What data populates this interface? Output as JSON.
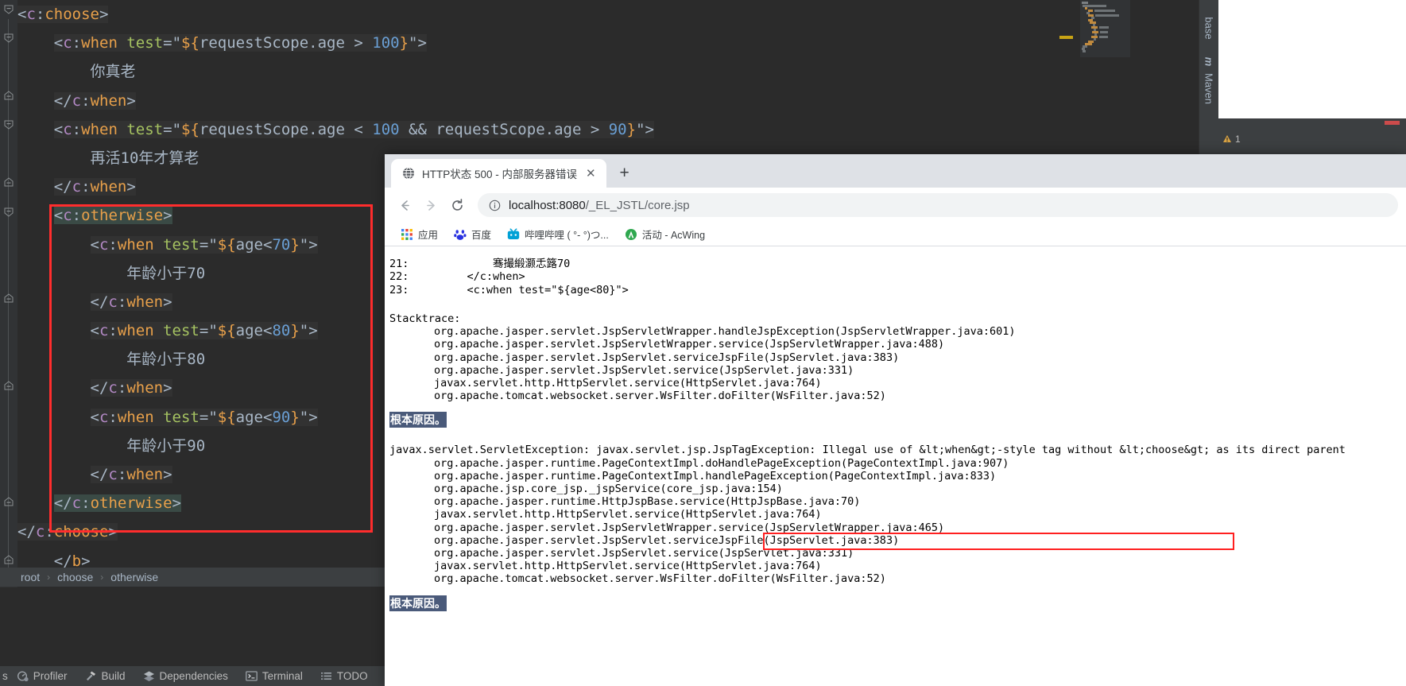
{
  "ide": {
    "editor_code": [
      {
        "indent": 0,
        "bg": "hl",
        "tokens": [
          {
            "t": "<",
            "c": "punc"
          },
          {
            "t": "c",
            "c": "ns"
          },
          {
            "t": ":",
            "c": "punc"
          },
          {
            "t": "choose",
            "c": "tag"
          },
          {
            "t": ">",
            "c": "punc"
          }
        ]
      },
      {
        "indent": 1,
        "bg": "hl",
        "tokens": [
          {
            "t": "<",
            "c": "punc"
          },
          {
            "t": "c",
            "c": "ns"
          },
          {
            "t": ":",
            "c": "punc"
          },
          {
            "t": "when",
            "c": "tag"
          },
          {
            "t": " ",
            "c": "punc"
          },
          {
            "t": "test",
            "c": "attr"
          },
          {
            "t": "=",
            "c": "punc"
          },
          {
            "t": "\"",
            "c": "str"
          },
          {
            "t": "${",
            "c": "el"
          },
          {
            "t": "requestScope.age",
            "c": "str"
          },
          {
            "t": " > ",
            "c": "op"
          },
          {
            "t": "100",
            "c": "num"
          },
          {
            "t": "}",
            "c": "el"
          },
          {
            "t": "\"",
            "c": "str"
          },
          {
            "t": ">",
            "c": "punc"
          }
        ]
      },
      {
        "indent": 2,
        "bg": "",
        "tokens": [
          {
            "t": "你真老",
            "c": "txt"
          }
        ]
      },
      {
        "indent": 1,
        "bg": "hl",
        "tokens": [
          {
            "t": "</",
            "c": "punc"
          },
          {
            "t": "c",
            "c": "ns"
          },
          {
            "t": ":",
            "c": "punc"
          },
          {
            "t": "when",
            "c": "tag"
          },
          {
            "t": ">",
            "c": "punc"
          }
        ]
      },
      {
        "indent": 1,
        "bg": "hl",
        "tokens": [
          {
            "t": "<",
            "c": "punc"
          },
          {
            "t": "c",
            "c": "ns"
          },
          {
            "t": ":",
            "c": "punc"
          },
          {
            "t": "when",
            "c": "tag"
          },
          {
            "t": " ",
            "c": "punc"
          },
          {
            "t": "test",
            "c": "attr"
          },
          {
            "t": "=",
            "c": "punc"
          },
          {
            "t": "\"",
            "c": "str"
          },
          {
            "t": "${",
            "c": "el"
          },
          {
            "t": "requestScope.age",
            "c": "str"
          },
          {
            "t": " < ",
            "c": "op"
          },
          {
            "t": "100",
            "c": "num"
          },
          {
            "t": " && ",
            "c": "op"
          },
          {
            "t": "requestScope.age",
            "c": "str"
          },
          {
            "t": " > ",
            "c": "op"
          },
          {
            "t": "90",
            "c": "num"
          },
          {
            "t": "}",
            "c": "el"
          },
          {
            "t": "\"",
            "c": "str"
          },
          {
            "t": ">",
            "c": "punc"
          }
        ]
      },
      {
        "indent": 2,
        "bg": "",
        "tokens": [
          {
            "t": "再活10年才算老",
            "c": "txt"
          }
        ]
      },
      {
        "indent": 1,
        "bg": "hl",
        "tokens": [
          {
            "t": "</",
            "c": "punc"
          },
          {
            "t": "c",
            "c": "ns"
          },
          {
            "t": ":",
            "c": "punc"
          },
          {
            "t": "when",
            "c": "tag"
          },
          {
            "t": ">",
            "c": "punc"
          }
        ]
      },
      {
        "indent": 1,
        "bg": "sel",
        "tokens": [
          {
            "t": "<",
            "c": "punc"
          },
          {
            "t": "c",
            "c": "ns"
          },
          {
            "t": ":",
            "c": "punc"
          },
          {
            "t": "otherwise",
            "c": "tag"
          },
          {
            "t": ">",
            "c": "punc"
          }
        ]
      },
      {
        "indent": 2,
        "bg": "hl",
        "tokens": [
          {
            "t": "<",
            "c": "punc"
          },
          {
            "t": "c",
            "c": "ns"
          },
          {
            "t": ":",
            "c": "punc"
          },
          {
            "t": "when",
            "c": "tag"
          },
          {
            "t": " ",
            "c": "punc"
          },
          {
            "t": "test",
            "c": "attr"
          },
          {
            "t": "=",
            "c": "punc"
          },
          {
            "t": "\"",
            "c": "str"
          },
          {
            "t": "${",
            "c": "el"
          },
          {
            "t": "age",
            "c": "str"
          },
          {
            "t": "<",
            "c": "op"
          },
          {
            "t": "70",
            "c": "num"
          },
          {
            "t": "}",
            "c": "el"
          },
          {
            "t": "\"",
            "c": "str"
          },
          {
            "t": ">",
            "c": "punc"
          }
        ]
      },
      {
        "indent": 3,
        "bg": "",
        "tokens": [
          {
            "t": "年龄小于70",
            "c": "txt"
          }
        ]
      },
      {
        "indent": 2,
        "bg": "hl",
        "tokens": [
          {
            "t": "</",
            "c": "punc"
          },
          {
            "t": "c",
            "c": "ns"
          },
          {
            "t": ":",
            "c": "punc"
          },
          {
            "t": "when",
            "c": "tag"
          },
          {
            "t": ">",
            "c": "punc"
          }
        ]
      },
      {
        "indent": 2,
        "bg": "hl",
        "tokens": [
          {
            "t": "<",
            "c": "punc"
          },
          {
            "t": "c",
            "c": "ns"
          },
          {
            "t": ":",
            "c": "punc"
          },
          {
            "t": "when",
            "c": "tag"
          },
          {
            "t": " ",
            "c": "punc"
          },
          {
            "t": "test",
            "c": "attr"
          },
          {
            "t": "=",
            "c": "punc"
          },
          {
            "t": "\"",
            "c": "str"
          },
          {
            "t": "${",
            "c": "el"
          },
          {
            "t": "age",
            "c": "str"
          },
          {
            "t": "<",
            "c": "op"
          },
          {
            "t": "80",
            "c": "num"
          },
          {
            "t": "}",
            "c": "el"
          },
          {
            "t": "\"",
            "c": "str"
          },
          {
            "t": ">",
            "c": "punc"
          }
        ]
      },
      {
        "indent": 3,
        "bg": "",
        "tokens": [
          {
            "t": "年龄小于80",
            "c": "txt"
          }
        ]
      },
      {
        "indent": 2,
        "bg": "hl",
        "tokens": [
          {
            "t": "</",
            "c": "punc"
          },
          {
            "t": "c",
            "c": "ns"
          },
          {
            "t": ":",
            "c": "punc"
          },
          {
            "t": "when",
            "c": "tag"
          },
          {
            "t": ">",
            "c": "punc"
          }
        ]
      },
      {
        "indent": 2,
        "bg": "hl",
        "tokens": [
          {
            "t": "<",
            "c": "punc"
          },
          {
            "t": "c",
            "c": "ns"
          },
          {
            "t": ":",
            "c": "punc"
          },
          {
            "t": "when",
            "c": "tag"
          },
          {
            "t": " ",
            "c": "punc"
          },
          {
            "t": "test",
            "c": "attr"
          },
          {
            "t": "=",
            "c": "punc"
          },
          {
            "t": "\"",
            "c": "str"
          },
          {
            "t": "${",
            "c": "el"
          },
          {
            "t": "age",
            "c": "str"
          },
          {
            "t": "<",
            "c": "op"
          },
          {
            "t": "90",
            "c": "num"
          },
          {
            "t": "}",
            "c": "el"
          },
          {
            "t": "\"",
            "c": "str"
          },
          {
            "t": ">",
            "c": "punc"
          }
        ]
      },
      {
        "indent": 3,
        "bg": "",
        "tokens": [
          {
            "t": "年龄小于90",
            "c": "txt"
          }
        ]
      },
      {
        "indent": 2,
        "bg": "hl",
        "tokens": [
          {
            "t": "</",
            "c": "punc"
          },
          {
            "t": "c",
            "c": "ns"
          },
          {
            "t": ":",
            "c": "punc"
          },
          {
            "t": "when",
            "c": "tag"
          },
          {
            "t": ">",
            "c": "punc"
          }
        ]
      },
      {
        "indent": 1,
        "bg": "sel",
        "tokens": [
          {
            "t": "</",
            "c": "punc"
          },
          {
            "t": "c",
            "c": "ns"
          },
          {
            "t": ":",
            "c": "punc"
          },
          {
            "t": "otherwise",
            "c": "tag"
          },
          {
            "t": ">",
            "c": "punc"
          }
        ]
      },
      {
        "indent": 0,
        "bg": "hl",
        "tokens": [
          {
            "t": "</",
            "c": "punc"
          },
          {
            "t": "c",
            "c": "ns"
          },
          {
            "t": ":",
            "c": "punc"
          },
          {
            "t": "choose",
            "c": "tag"
          },
          {
            "t": ">",
            "c": "punc"
          }
        ]
      },
      {
        "indent": 1,
        "bg": "",
        "tokens": [
          {
            "t": "</",
            "c": "punc"
          },
          {
            "t": "b",
            "c": "tag"
          },
          {
            "t": ">",
            "c": "punc"
          }
        ]
      }
    ],
    "breadcrumb": [
      "root",
      "choose",
      "otherwise"
    ],
    "toolbar_items": [
      {
        "label": "Profiler",
        "icon": "profiler-icon"
      },
      {
        "label": "Build",
        "icon": "build-hammer-icon"
      },
      {
        "label": "Dependencies",
        "icon": "dependencies-layers-icon"
      },
      {
        "label": "Terminal",
        "icon": "terminal-icon"
      },
      {
        "label": "TODO",
        "icon": "todo-list-icon"
      }
    ],
    "toolbar_partial_left": "s",
    "right_sidebar": [
      {
        "label": "base",
        "name": "database-tool-tab"
      },
      {
        "label": "Maven",
        "name": "maven-tool-tab"
      }
    ],
    "warning_count": "1"
  },
  "browser": {
    "tab": {
      "title": "HTTP状态 500 - 内部服务器错误",
      "favicon": "globe-icon",
      "close": "✕"
    },
    "new_tab_label": "+",
    "nav": {
      "back": "←",
      "forward": "→",
      "reload": "⟳"
    },
    "omnibox": {
      "info_icon": "info-circle-icon",
      "url_host": "localhost:8080",
      "url_path": "/_EL_JSTL/core.jsp"
    },
    "bookmarks": [
      {
        "label": "应用",
        "icon": "apps-grid-icon"
      },
      {
        "label": "百度",
        "icon": "baidu-paw-icon"
      },
      {
        "label": "哔哩哔哩 ( °- °)つ...",
        "icon": "bilibili-tv-icon"
      },
      {
        "label": "活动 - AcWing",
        "icon": "acwing-icon"
      }
    ],
    "page": {
      "source_lines": [
        "21:             骞撮緞灏忎簬70",
        "22:         </c:when>",
        "23:         <c:when test=\"${age<80}\">"
      ],
      "stacktrace_label": "Stacktrace:",
      "stacktrace_1": [
        "org.apache.jasper.servlet.JspServletWrapper.handleJspException(JspServletWrapper.java:601)",
        "org.apache.jasper.servlet.JspServletWrapper.service(JspServletWrapper.java:488)",
        "org.apache.jasper.servlet.JspServlet.serviceJspFile(JspServlet.java:383)",
        "org.apache.jasper.servlet.JspServlet.service(JspServlet.java:331)",
        "javax.servlet.http.HttpServlet.service(HttpServlet.java:764)",
        "org.apache.tomcat.websocket.server.WsFilter.doFilter(WsFilter.java:52)"
      ],
      "root_cause_label_1": "根本原因。",
      "exception_prefix": "javax.servlet.ServletException: javax.servlet.jsp.JspTagException: ",
      "exception_message": "Illegal use of &lt;when&gt;-style tag without &lt;choose&gt; as its direct parent",
      "stacktrace_2": [
        "org.apache.jasper.runtime.PageContextImpl.doHandlePageException(PageContextImpl.java:907)",
        "org.apache.jasper.runtime.PageContextImpl.handlePageException(PageContextImpl.java:833)",
        "org.apache.jsp.core_jsp._jspService(core_jsp.java:154)",
        "org.apache.jasper.runtime.HttpJspBase.service(HttpJspBase.java:70)",
        "javax.servlet.http.HttpServlet.service(HttpServlet.java:764)",
        "org.apache.jasper.servlet.JspServletWrapper.service(JspServletWrapper.java:465)",
        "org.apache.jasper.servlet.JspServlet.serviceJspFile(JspServlet.java:383)",
        "org.apache.jasper.servlet.JspServlet.service(JspServlet.java:331)",
        "javax.servlet.http.HttpServlet.service(HttpServlet.java:764)",
        "org.apache.tomcat.websocket.server.WsFilter.doFilter(WsFilter.java:52)"
      ],
      "root_cause_label_2": "根本原因。"
    }
  },
  "colors": {
    "annotation_red": "#ff2d2d",
    "ide_bg": "#2b2b2b",
    "ide_panel": "#3c3f41",
    "tag_orange": "#e8a04a",
    "ns_purple": "#b389c5",
    "attr_green": "#a5c261",
    "num_blue": "#6a9fd4"
  }
}
